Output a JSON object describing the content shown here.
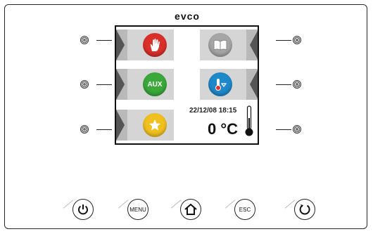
{
  "brand": "evco",
  "screen": {
    "datetime": "22/12/08 18:15",
    "temperature": "0 °C",
    "tiles": [
      {
        "side": "left",
        "icon": "stop-hand-icon",
        "color": "#d9302a"
      },
      {
        "side": "right",
        "icon": "book-icon",
        "color": "#9a9a9a"
      },
      {
        "side": "left",
        "label": "AUX",
        "icon": "aux-icon",
        "color": "#3aa83a"
      },
      {
        "side": "right",
        "icon": "thermometer-setpoint-icon",
        "color": "#1e88c8"
      },
      {
        "side": "left",
        "icon": "star-icon",
        "color": "#f0c020"
      }
    ]
  },
  "buttons": {
    "power": {
      "icon": "power-icon"
    },
    "menu": {
      "label": "MENU"
    },
    "home": {
      "icon": "home-icon"
    },
    "esc": {
      "label": "ESC"
    },
    "refresh": {
      "icon": "refresh-icon"
    }
  },
  "colors": {
    "stop": "#d9302a",
    "aux": "#3aa83a",
    "star": "#f0c020",
    "thermo": "#1e88c8",
    "book": "#9a9a9a"
  }
}
